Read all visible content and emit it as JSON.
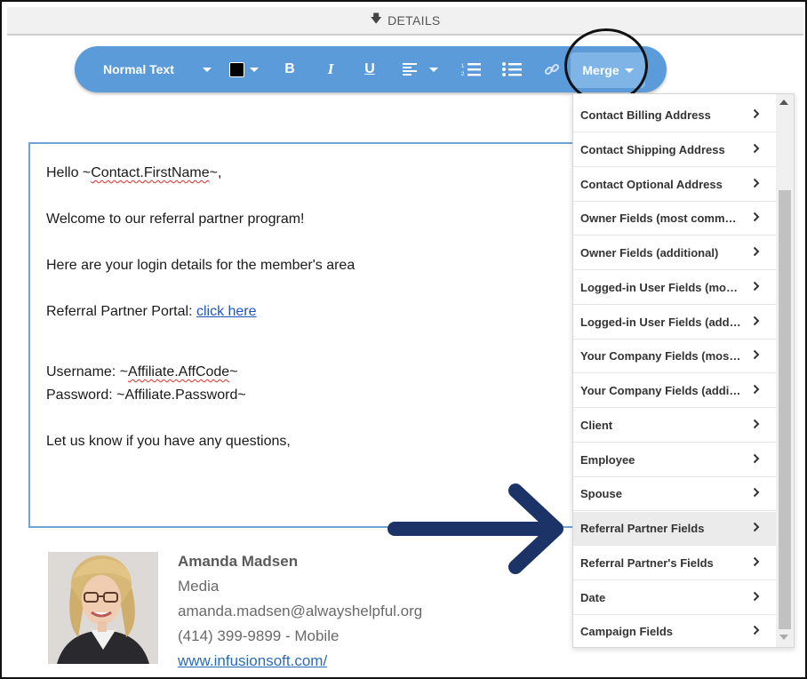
{
  "details_bar": {
    "label": "DETAILS"
  },
  "toolbar": {
    "text_style": "Normal Text",
    "color": "#000000",
    "bold": "B",
    "italic": "I",
    "underline": "U",
    "merge_label": "Merge",
    "accent": "#5b9bd9"
  },
  "editor": {
    "greeting_prefix": "Hello ~",
    "greeting_field": "Contact.FirstName",
    "greeting_suffix": "~,",
    "welcome": "Welcome to our referral partner program!",
    "login_details": "Here are your login details for the member's area",
    "portal_prefix": "Referral Partner Portal: ",
    "portal_link": "click here",
    "username_prefix": "Username: ~",
    "username_field": "Affiliate.AffCode",
    "username_suffix": "~",
    "password": "Password: ~Affiliate.Password~",
    "closing": "Let us know if you have any questions,"
  },
  "signature": {
    "name": "Amanda Madsen",
    "title": "Media",
    "email": "amanda.madsen@alwayshelpful.org",
    "phone": "(414) 399-9899 - Mobile",
    "website": "www.infusionsoft.com/"
  },
  "merge_menu": {
    "highlighted": "Referral Partner Fields",
    "items": [
      "Contact Billing Address",
      "Contact Shipping Address",
      "Contact Optional Address",
      "Owner Fields (most common)",
      "Owner Fields (additional)",
      "Logged-in User Fields (most common)",
      "Logged-in User Fields (additional)",
      "Your Company Fields (most common)",
      "Your Company Fields (additional)",
      "Client",
      "Employee",
      "Spouse",
      "Referral Partner Fields",
      "Referral Partner's Fields",
      "Date",
      "Campaign Fields"
    ]
  },
  "annotation": {
    "arrow_color": "#1b3366",
    "circle_color": "#111111"
  }
}
